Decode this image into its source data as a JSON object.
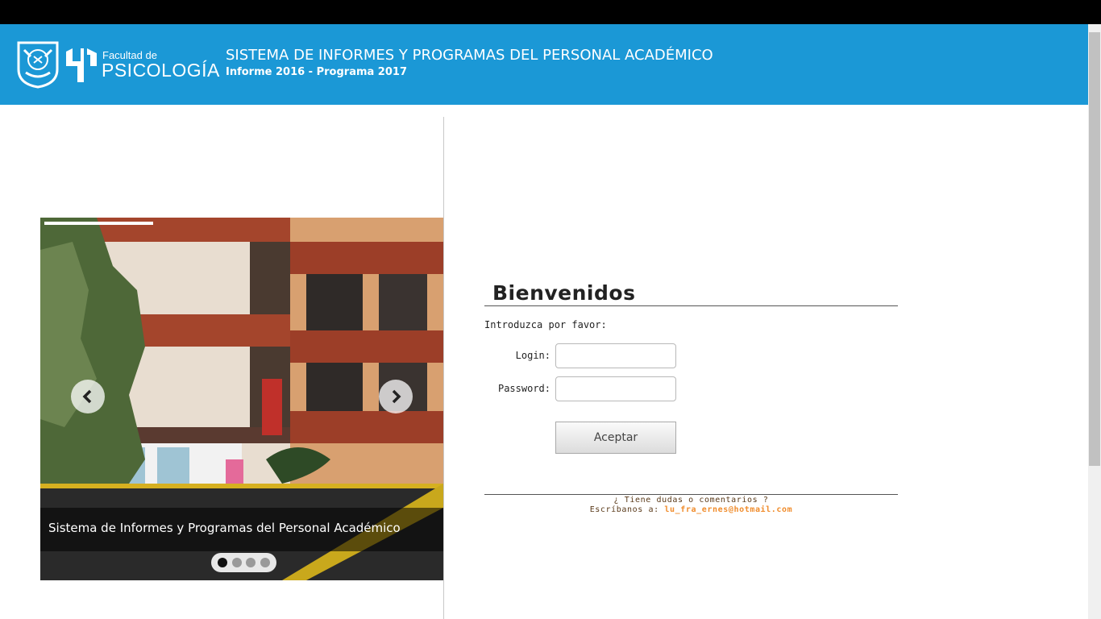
{
  "header": {
    "faculty_small": "Facultad de",
    "faculty_big": "PSICOLOGÍA",
    "title": "SISTEMA DE INFORMES Y PROGRAMAS DEL PERSONAL ACADÉMICO",
    "subtitle": "Informe 2016 - Programa 2017"
  },
  "slider": {
    "caption": "Sistema de Informes y Programas del Personal Académico",
    "slide_count": 4,
    "active_slide": 1,
    "prev_icon": "chevron-left-icon",
    "next_icon": "chevron-right-icon"
  },
  "login": {
    "heading": "Bienvenidos",
    "intro": "Introduzca por favor:",
    "login_label": "Login:",
    "password_label": "Password:",
    "login_value": "",
    "password_value": "",
    "submit_label": "Aceptar"
  },
  "footer": {
    "doubts": "¿ Tiene dudas o comentarios ?",
    "contact_prefix": "Escríbanos a:",
    "email": "lu_fra_ernes@hotmail.com"
  },
  "colors": {
    "header_bg": "#1b98d6",
    "top_bar": "#000000",
    "email_accent": "#f08c2c"
  }
}
